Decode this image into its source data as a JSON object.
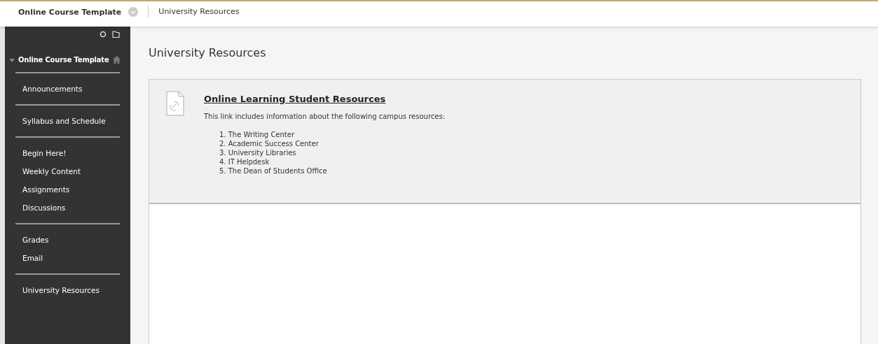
{
  "breadcrumbs": [
    {
      "label": "Online Course Template",
      "current": true
    },
    {
      "label": "University Resources",
      "current": false
    }
  ],
  "sidebar": {
    "course_title": "Online Course Template",
    "expanded": true,
    "groups": [
      [
        "Announcements"
      ],
      [
        "Syllabus and Schedule"
      ],
      [
        "Begin Here!",
        "Weekly Content",
        "Assignments",
        "Discussions"
      ],
      [
        "Grades",
        "Email"
      ],
      [
        "University Resources"
      ]
    ]
  },
  "page_title": "University Resources",
  "item": {
    "title": "Online Learning Student Resources",
    "description": "This link includes information about the following campus resources:",
    "list": [
      "1. The Writing Center",
      "2. Academic Success Center",
      "3. University Libraries",
      "4. IT Helpdesk",
      "5. The Dean of Students Office"
    ]
  }
}
